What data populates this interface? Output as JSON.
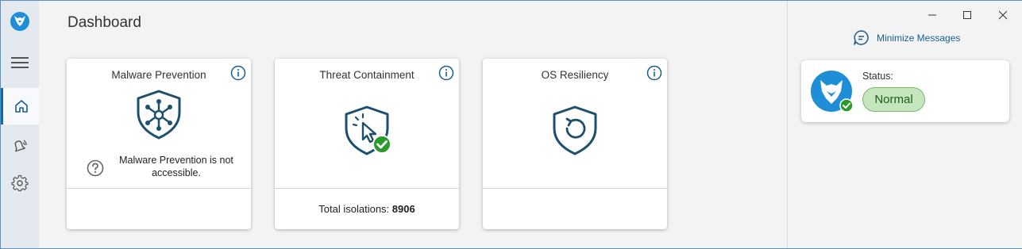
{
  "page": {
    "title": "Dashboard"
  },
  "nav": {
    "items": [
      {
        "icon": "menu-icon"
      },
      {
        "icon": "home-icon",
        "active": true
      },
      {
        "icon": "notifications-icon"
      },
      {
        "icon": "settings-icon"
      }
    ]
  },
  "cards": [
    {
      "title": "Malware Prevention",
      "icon": "shield-network-icon",
      "message": "Malware Prevention is not accessible.",
      "footer": ""
    },
    {
      "title": "Threat Containment",
      "icon": "shield-cursor-icon",
      "footer_label": "Total isolations:",
      "footer_value": "8906"
    },
    {
      "title": "OS Resiliency",
      "icon": "shield-restore-icon",
      "footer": ""
    }
  ],
  "right_pane": {
    "minimize_messages": "Minimize Messages",
    "status_label": "Status:",
    "status_value": "Normal"
  },
  "colors": {
    "accent": "#1e8fd6",
    "icon_dark": "#1d4f6e",
    "success": "#2a9a2a",
    "status_bg": "#c5e5bd"
  }
}
